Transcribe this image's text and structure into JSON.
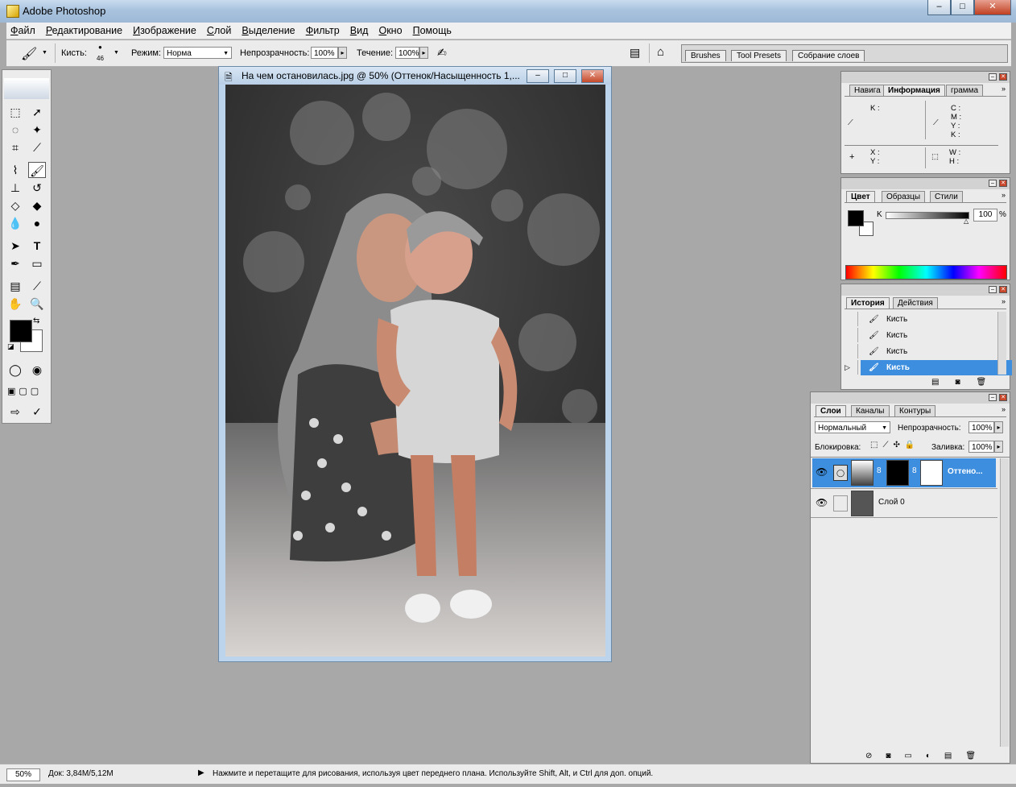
{
  "app": {
    "title": "Adobe Photoshop"
  },
  "menu": [
    "Файл",
    "Редактирование",
    "Изображение",
    "Слой",
    "Выделение",
    "Фильтр",
    "Вид",
    "Окно",
    "Помощь"
  ],
  "options": {
    "brush_label": "Кисть:",
    "brush_size": "46",
    "mode_label": "Режим:",
    "mode_value": "Норма",
    "opacity_label": "Непрозрачность:",
    "opacity_value": "100%",
    "flow_label": "Течение:",
    "flow_value": "100%",
    "well_tabs": [
      "Brushes",
      "Tool Presets",
      "Собрание слоев"
    ]
  },
  "document": {
    "title": "На чем остановилась.jpg @ 50% (Оттенок/Насыщенность 1,..."
  },
  "info_panel": {
    "tabs": [
      "Навига",
      "Информация",
      "грамма"
    ],
    "k": "K :",
    "cmyk": [
      "C :",
      "M :",
      "Y :",
      "K :"
    ],
    "xy": [
      "X :",
      "Y :"
    ],
    "wh": [
      "W :",
      "H :"
    ]
  },
  "color_panel": {
    "tabs": [
      "Цвет",
      "Образцы",
      "Стили"
    ],
    "channel_label": "K",
    "value": "100",
    "unit": "%"
  },
  "history_panel": {
    "tabs": [
      "История",
      "Действия"
    ],
    "items": [
      "Кисть",
      "Кисть",
      "Кисть",
      "Кисть"
    ]
  },
  "layers_panel": {
    "tabs": [
      "Слои",
      "Каналы",
      "Контуры"
    ],
    "blend_mode": "Нормальный",
    "opacity_label": "Непрозрачность:",
    "opacity_value": "100%",
    "lock_label": "Блокировка:",
    "fill_label": "Заливка:",
    "fill_value": "100%",
    "layers": [
      {
        "name": "Оттено..."
      },
      {
        "name": "Слой 0"
      }
    ]
  },
  "status": {
    "zoom": "50%",
    "doc_size": "Док: 3,84M/5,12M",
    "hint": "Нажмите и перетащите для рисования, используя цвет переднего плана. Используйте Shift, Alt, и Ctrl для доп. опций."
  },
  "colors": {
    "selection": "#3d8ede",
    "foreground": "#000000",
    "background": "#ffffff"
  }
}
